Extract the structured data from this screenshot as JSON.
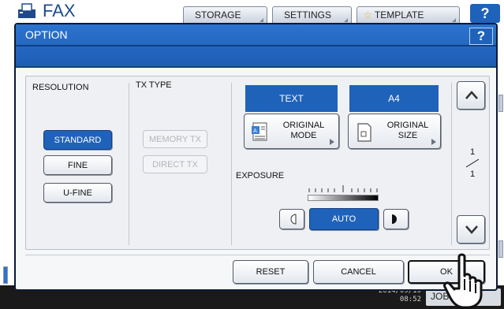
{
  "background": {
    "app_title": "FAX",
    "tabs": [
      "STORAGE",
      "SETTINGS",
      "TEMPLATE"
    ],
    "help_label": "?",
    "clock": "08:52",
    "clock_date": "2014/09/10",
    "jobs_label": "JOBS"
  },
  "dialog": {
    "title": "OPTION",
    "help_label": "?"
  },
  "resolution": {
    "label": "RESOLUTION",
    "options": [
      "STANDARD",
      "FINE",
      "U-FINE"
    ],
    "selected": "STANDARD"
  },
  "tx_type": {
    "label": "TX TYPE",
    "options": [
      "MEMORY TX",
      "DIRECT TX"
    ]
  },
  "original_mode": {
    "value": "TEXT",
    "button_label": "ORIGINAL MODE"
  },
  "original_size": {
    "value": "A4",
    "button_label": "ORIGINAL SIZE"
  },
  "exposure": {
    "label": "EXPOSURE",
    "value_label": "AUTO"
  },
  "paging": {
    "current": "1",
    "total": "1"
  },
  "footer": {
    "reset_label": "RESET",
    "cancel_label": "CANCEL",
    "ok_label": "OK"
  },
  "colors": {
    "accent_blue": "#1f62ba",
    "header_blue": "#2b73cf",
    "frame": "#0b1a35"
  },
  "icons": [
    "fax-icon",
    "original-mode-icon",
    "original-size-icon",
    "expand-triangle-icon",
    "lighter-icon",
    "darker-icon",
    "scroll-up-icon",
    "scroll-down-icon",
    "hand-cursor-icon"
  ]
}
